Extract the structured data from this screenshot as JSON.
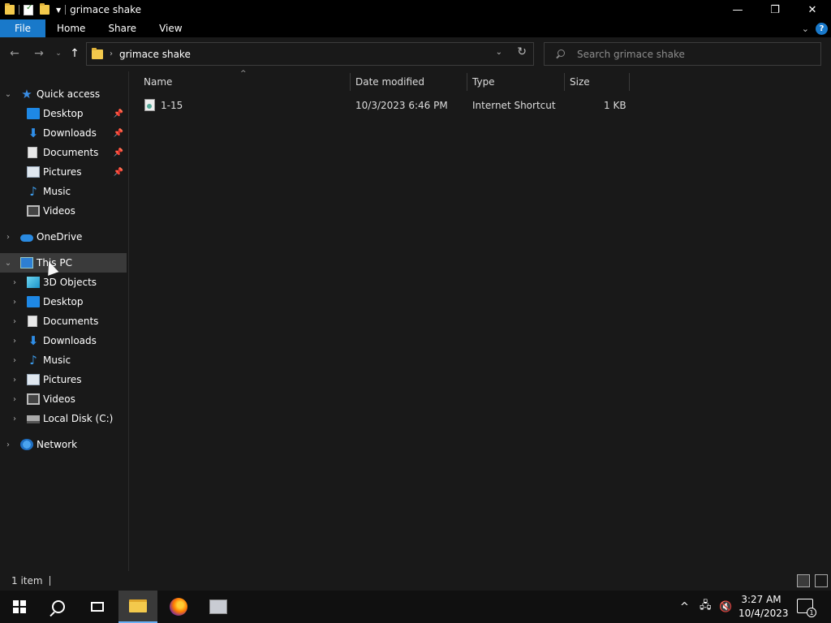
{
  "window": {
    "title": "grimace shake",
    "minimize_glyph": "—",
    "restore_glyph": "❐",
    "close_glyph": "✕"
  },
  "ribbon": {
    "tabs": [
      {
        "label": "File"
      },
      {
        "label": "Home"
      },
      {
        "label": "Share"
      },
      {
        "label": "View"
      }
    ],
    "help_glyph": "?"
  },
  "address": {
    "crumbs": [
      "grimace shake"
    ]
  },
  "search": {
    "placeholder": "Search grimace shake"
  },
  "nav": {
    "quick_access": {
      "label": "Quick access",
      "items": [
        {
          "label": "Desktop",
          "pinned": true
        },
        {
          "label": "Downloads",
          "pinned": true
        },
        {
          "label": "Documents",
          "pinned": true
        },
        {
          "label": "Pictures",
          "pinned": true
        },
        {
          "label": "Music",
          "pinned": false
        },
        {
          "label": "Videos",
          "pinned": false
        }
      ]
    },
    "onedrive": {
      "label": "OneDrive"
    },
    "this_pc": {
      "label": "This PC",
      "items": [
        {
          "label": "3D Objects"
        },
        {
          "label": "Desktop"
        },
        {
          "label": "Documents"
        },
        {
          "label": "Downloads"
        },
        {
          "label": "Music"
        },
        {
          "label": "Pictures"
        },
        {
          "label": "Videos"
        },
        {
          "label": "Local Disk (C:)"
        }
      ]
    },
    "network": {
      "label": "Network"
    }
  },
  "columns": {
    "name": "Name",
    "date_modified": "Date modified",
    "type": "Type",
    "size": "Size"
  },
  "files": [
    {
      "name": "1-15",
      "date_modified": "10/3/2023 6:46 PM",
      "type": "Internet Shortcut",
      "size": "1 KB"
    }
  ],
  "status": {
    "item_count": "1 item"
  },
  "taskbar": {
    "time": "3:27 AM",
    "date": "10/4/2023",
    "notification_count": "1"
  },
  "colors": {
    "accent": "#1979ca",
    "background": "#191919",
    "titlebar": "#000000",
    "selected": "#3a3a3a"
  }
}
